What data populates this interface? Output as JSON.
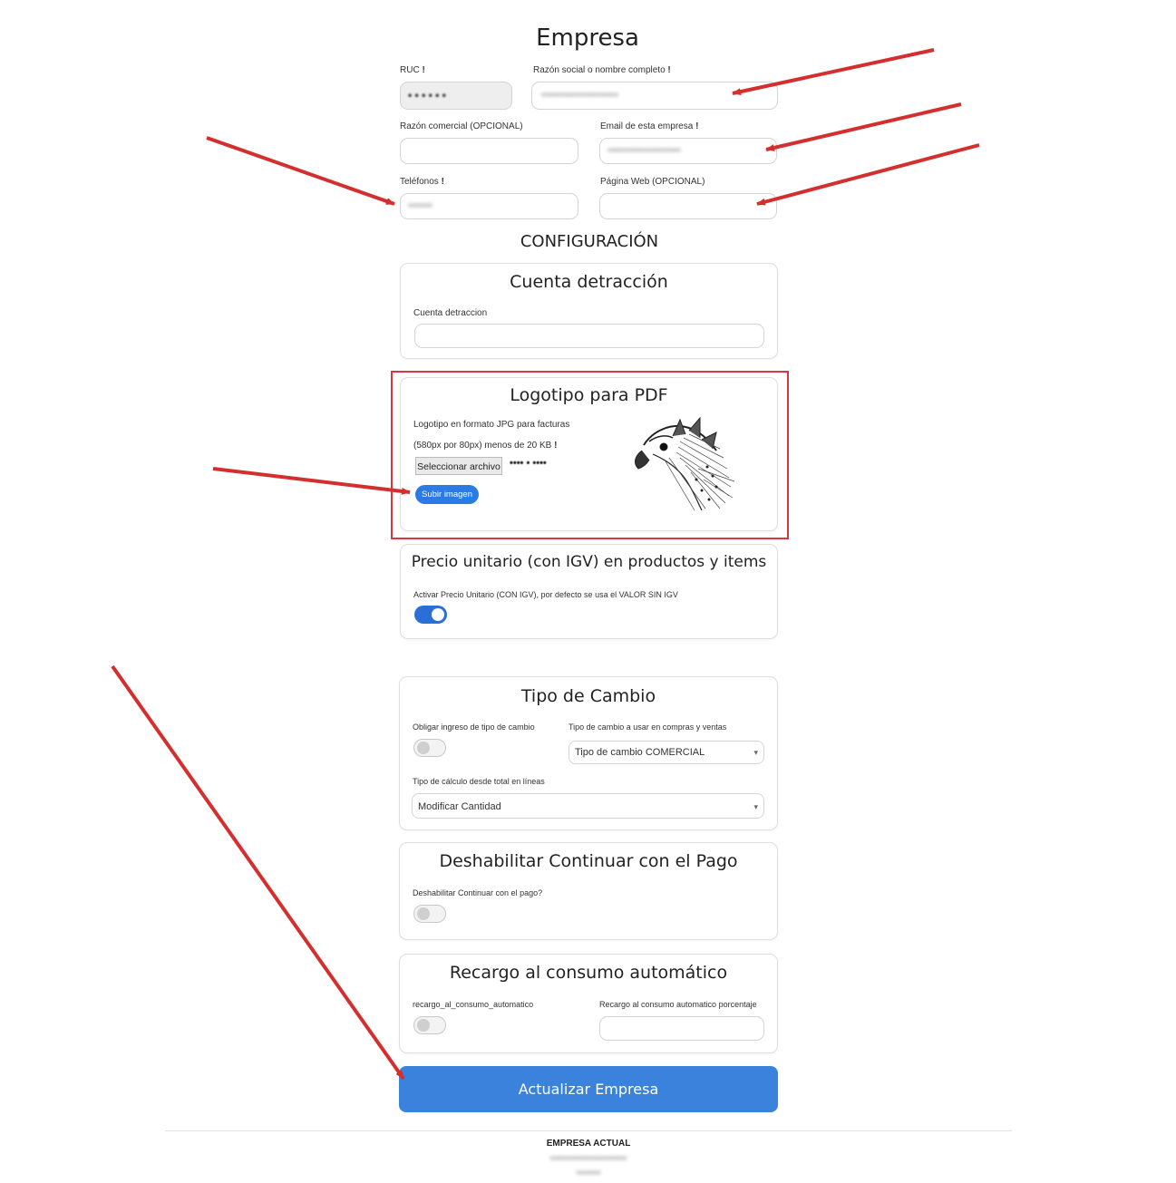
{
  "page_title": "Empresa",
  "fields": {
    "ruc_label": "RUC",
    "ruc_value": "• • • • • •",
    "razon_social_label": "Razón social o nombre completo",
    "razon_social_value": "••••••••••••••••••••••",
    "razon_comercial_label": "Razón comercial (OPCIONAL)",
    "email_label": "Email de esta empresa",
    "email_value": "•••••••••••••••••••••",
    "telefonos_label": "Teléfonos",
    "telefonos_value": "•••••••",
    "pagina_web_label": "Página Web (OPCIONAL)",
    "required_mark": "!"
  },
  "config_heading": "CONFIGURACIÓN",
  "cuenta_detraccion": {
    "title": "Cuenta detracción",
    "label": "Cuenta detraccion"
  },
  "logotipo": {
    "title": "Logotipo para PDF",
    "help_line1": "Logotipo en formato JPG para facturas",
    "help_line2": "(580px por 80px) menos de 20 KB",
    "file_button": "Seleccionar archivo",
    "file_name": "•••• • ••••",
    "upload_button": "Subir imagen"
  },
  "precio_unitario": {
    "title": "Precio unitario (con IGV) en productos y items",
    "label": "Activar Precio Unitario (CON IGV), por defecto se usa el VALOR SIN IGV",
    "enabled": true
  },
  "tipo_cambio": {
    "title": "Tipo de Cambio",
    "obligar_label": "Obligar ingreso de tipo de cambio",
    "tipo_label": "Tipo de cambio a usar en compras y ventas",
    "tipo_selected": "Tipo de cambio COMERCIAL",
    "calculo_label": "Tipo de cálculo desde total en líneas",
    "calculo_selected": "Modificar Cantidad",
    "obligar_enabled": false
  },
  "deshabilitar_pago": {
    "title": "Deshabilitar Continuar con el Pago",
    "label": "Deshabilitar Continuar con el pago?",
    "enabled": false
  },
  "recargo": {
    "title": "Recargo al consumo automático",
    "toggle_label": "recargo_al_consumo_automatico",
    "percent_label": "Recargo al consumo automatico porcentaje",
    "enabled": false
  },
  "submit_button": "Actualizar Empresa",
  "footer": {
    "heading": "EMPRESA ACTUAL",
    "line1": "••••••••••••••••••••••",
    "line2": "•••••••"
  },
  "colors": {
    "accent": "#2a6fd6",
    "submit": "#3b82dc",
    "highlight_border": "#d9363e",
    "annotation_arrow": "#d32f2f"
  }
}
